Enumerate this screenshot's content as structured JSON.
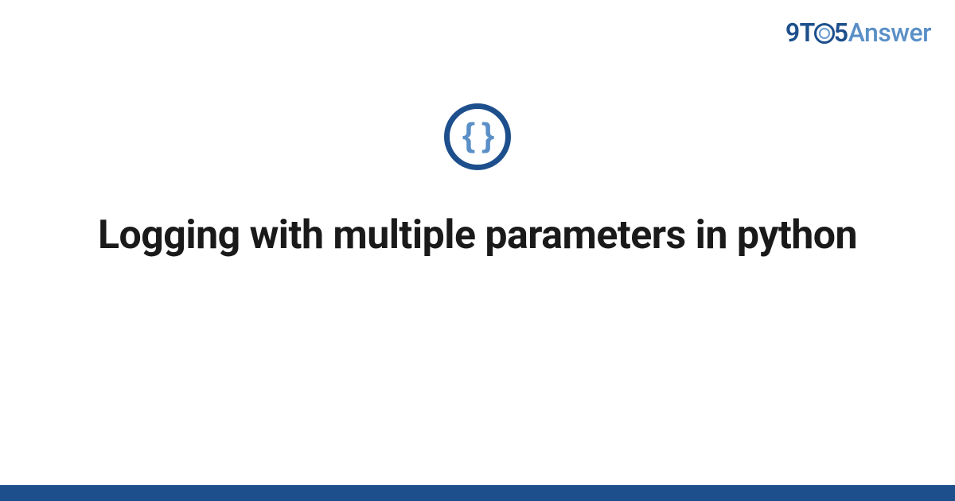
{
  "logo": {
    "part_9t": "9T",
    "part_5": "5",
    "part_answer": "Answer",
    "icon_name": "clock-o-icon"
  },
  "center_icon": {
    "glyph": "{ }",
    "name": "code-braces-icon"
  },
  "title": "Logging with multiple parameters in python",
  "colors": {
    "brand_dark": "#1d4f8c",
    "brand_light": "#5a8fc7"
  }
}
